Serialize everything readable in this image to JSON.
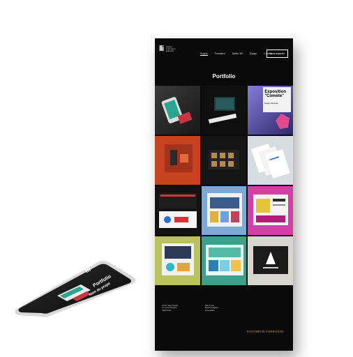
{
  "desktop": {
    "logo": "lli",
    "logo_sub": "Atelier Formation Éditorial",
    "nav": [
      "Projets",
      "Formation",
      "Atelier 3D",
      "Équipe",
      "Contact"
    ],
    "cta": "Nous rejoindre",
    "title": "Portfolio",
    "subtitle": "...",
    "tiles": [
      {
        "label": "",
        "sub": ""
      },
      {
        "label": "",
        "sub": ""
      },
      {
        "label": "Exposition \"Comète\"",
        "sub": "Design d'écriture"
      },
      {
        "label": "",
        "sub": ""
      },
      {
        "label": "",
        "sub": ""
      },
      {
        "label": "",
        "sub": ""
      },
      {
        "label": "",
        "sub": ""
      },
      {
        "label": "",
        "sub": ""
      },
      {
        "label": "",
        "sub": ""
      },
      {
        "label": "",
        "sub": ""
      },
      {
        "label": "",
        "sub": ""
      },
      {
        "label": "",
        "sub": ""
      }
    ],
    "footer": {
      "col1": [
        "Centre Saint-Charles",
        "47 rue des Bergers",
        "75015 Paris"
      ],
      "col2": [
        "Plan du site",
        "Mentions légales",
        "Accessibilité"
      ],
      "brand": "PANTHÉON SORBONNE"
    }
  },
  "phone": {
    "logo": "lli",
    "title": "Portfolio",
    "section": "Nom du projet"
  },
  "colors": {
    "background": "#ffffff",
    "page": "#0a0a0a",
    "gold": "#c9a24a"
  }
}
